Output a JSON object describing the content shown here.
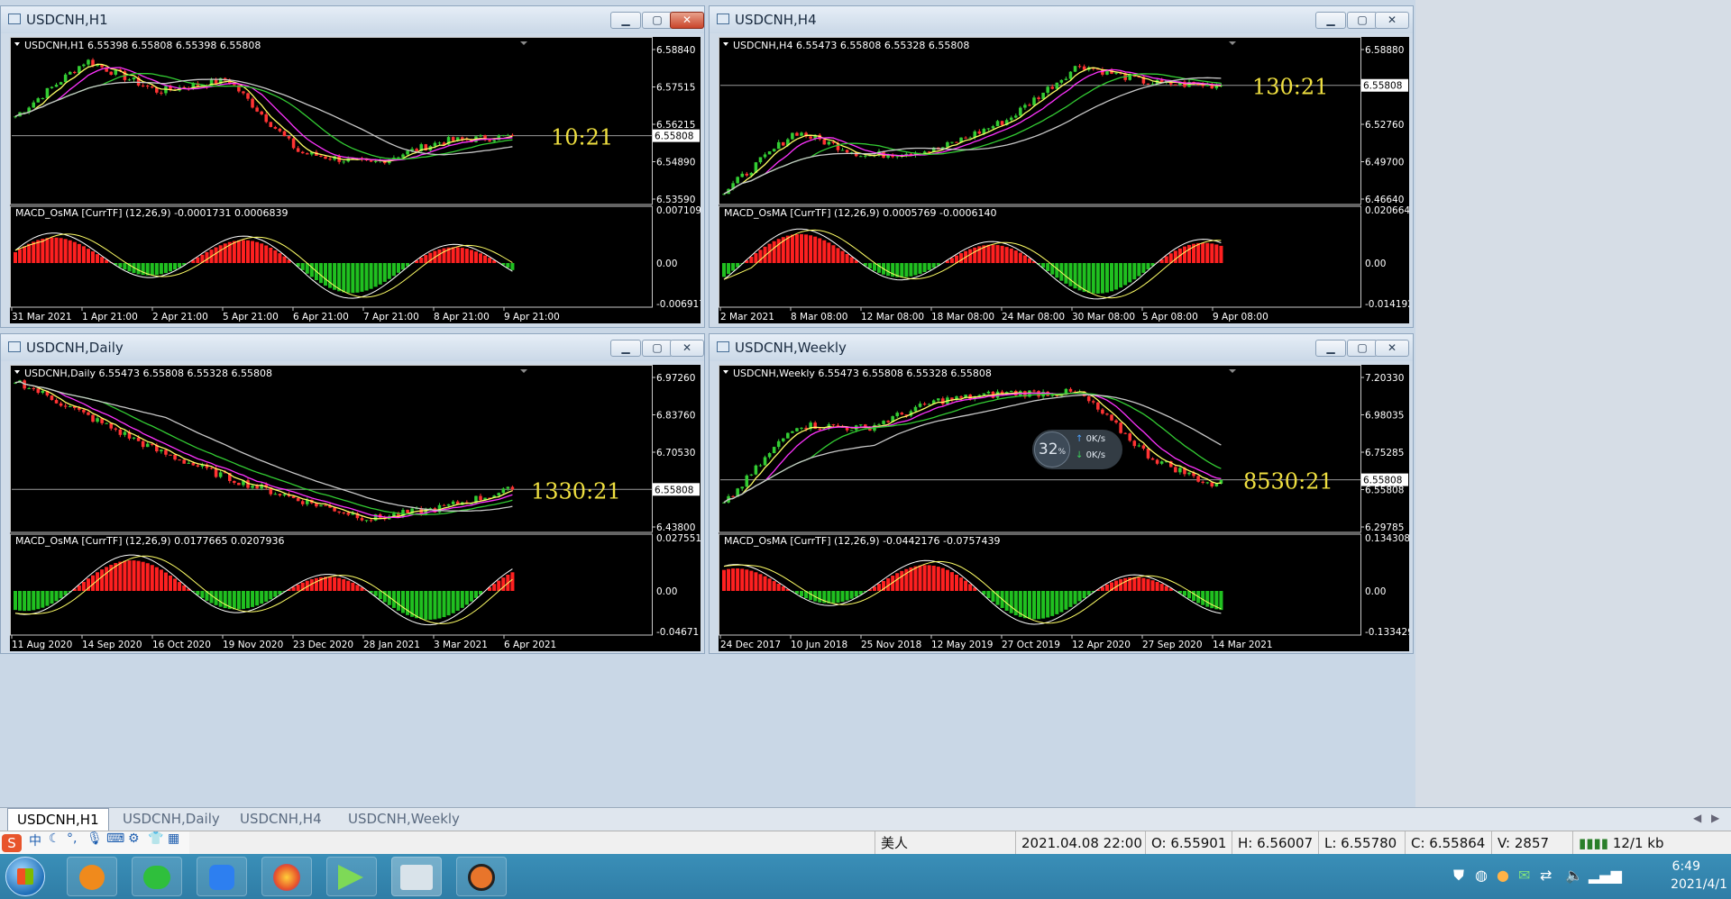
{
  "windows": [
    {
      "id": "h1",
      "title": "USDCNH,H1",
      "header": "USDCNH,H1  6.55398 6.55808 6.55398 6.55808",
      "price_ticks": [
        "6.58840",
        "6.57515",
        "6.56215",
        "6.54890",
        "6.53590"
      ],
      "current_price": "6.55808",
      "macd_label": "MACD_OsMA [CurrTF] (12,26,9) -0.0001731 0.0006839",
      "macd_ticks": [
        "0.007109",
        "0.00",
        "-0.006917"
      ],
      "time_labels": [
        "31 Mar 2021",
        "1 Apr 21:00",
        "2 Apr 21:00",
        "5 Apr 21:00",
        "6 Apr 21:00",
        "7 Apr 21:00",
        "8 Apr 21:00",
        "9 Apr 21:00"
      ],
      "countdown": "10:21",
      "chart_data": {
        "type": "line",
        "ylim": [
          6.5335,
          6.5908
        ],
        "current": 6.55808,
        "x": [
          "31 Mar 2021",
          "1 Apr 21:00",
          "2 Apr 21:00",
          "5 Apr 21:00",
          "6 Apr 21:00",
          "7 Apr 21:00",
          "8 Apr 21:00",
          "9 Apr 21:00"
        ],
        "series": [
          {
            "values": [
              6.565,
              6.585,
              6.574,
              6.578,
              6.552,
              6.548,
              6.556,
              6.558
            ]
          }
        ]
      }
    },
    {
      "id": "h4",
      "title": "USDCNH,H4",
      "header": "USDCNH,H4  6.55473 6.55808 6.55328 6.55808",
      "price_ticks": [
        "6.58880",
        "6.55808",
        "6.52760",
        "6.49700",
        "6.46640"
      ],
      "current_price": "6.55808",
      "macd_label": "MACD_OsMA [CurrTF] (12,26,9) 0.0005769 -0.0006140",
      "macd_ticks": [
        "0.0206644",
        "0.00",
        "-0.0141923"
      ],
      "time_labels": [
        "2 Mar 2021",
        "8 Mar 08:00",
        "12 Mar 08:00",
        "18 Mar 08:00",
        "24 Mar 08:00",
        "30 Mar 08:00",
        "5 Apr 08:00",
        "9 Apr 08:00"
      ],
      "countdown": "130:21",
      "chart_data": {
        "type": "line",
        "ylim": [
          6.46,
          6.592
        ],
        "current": 6.55808,
        "x": [
          "2 Mar 2021",
          "8 Mar 08:00",
          "12 Mar 08:00",
          "18 Mar 08:00",
          "24 Mar 08:00",
          "30 Mar 08:00",
          "5 Apr 08:00",
          "9 Apr 08:00"
        ],
        "series": [
          {
            "values": [
              6.47,
              6.52,
              6.5,
              6.505,
              6.53,
              6.575,
              6.56,
              6.558
            ]
          }
        ]
      }
    },
    {
      "id": "d1",
      "title": "USDCNH,Daily",
      "header": "USDCNH,Daily  6.55473 6.55808 6.55328 6.55808",
      "price_ticks": [
        "6.97260",
        "6.83760",
        "6.70530",
        "6.57060",
        "6.43800"
      ],
      "current_price": "6.55808",
      "macd_label": "MACD_OsMA [CurrTF] (12,26,9) 0.0177665 0.0207936",
      "macd_ticks": [
        "0.0275515",
        "0.00",
        "-0.04671"
      ],
      "time_labels": [
        "11 Aug 2020",
        "14 Sep 2020",
        "16 Oct 2020",
        "19 Nov 2020",
        "23 Dec 2020",
        "28 Jan 2021",
        "3 Mar 2021",
        "6 Apr 2021"
      ],
      "countdown": "1330:21",
      "chart_data": {
        "type": "line",
        "ylim": [
          6.4,
          6.99
        ],
        "current": 6.55808,
        "x": [
          "11 Aug 2020",
          "14 Sep 2020",
          "16 Oct 2020",
          "19 Nov 2020",
          "23 Dec 2020",
          "28 Jan 2021",
          "3 Mar 2021",
          "6 Apr 2021"
        ],
        "series": [
          {
            "values": [
              6.96,
              6.83,
              6.7,
              6.6,
              6.52,
              6.45,
              6.49,
              6.558
            ]
          }
        ]
      }
    },
    {
      "id": "w1",
      "title": "USDCNH,Weekly",
      "header": "USDCNH,Weekly  6.55473 6.55808 6.55328 6.55808",
      "price_ticks": [
        "7.20330",
        "6.98035",
        "6.75285",
        "6.55808",
        "6.29785"
      ],
      "current_price": "6.55808",
      "macd_label": "MACD_OsMA [CurrTF] (12,26,9) -0.0442176 -0.0757439",
      "macd_ticks": [
        "0.1343086",
        "0.00",
        "-0.1334299"
      ],
      "time_labels": [
        "24 Dec 2017",
        "10 Jun 2018",
        "25 Nov 2018",
        "12 May 2019",
        "27 Oct 2019",
        "12 Apr 2020",
        "27 Sep 2020",
        "14 Mar 2021"
      ],
      "countdown": "8530:21",
      "chart_data": {
        "type": "line",
        "ylim": [
          6.23,
          7.23
        ],
        "current": 6.55808,
        "x": [
          "24 Dec 2017",
          "10 Jun 2018",
          "25 Nov 2018",
          "12 May 2019",
          "27 Oct 2019",
          "12 Apr 2020",
          "27 Sep 2020",
          "14 Mar 2021"
        ],
        "series": [
          {
            "values": [
              6.4,
              6.9,
              6.88,
              7.05,
              7.1,
              7.1,
              6.7,
              6.5
            ]
          }
        ]
      }
    }
  ],
  "tabs": [
    "USDCNH,H1",
    "USDCNH,Daily",
    "USDCNH,H4",
    "USDCNH,Weekly"
  ],
  "status": {
    "profile": "美人",
    "datetime": "2021.04.08 22:00",
    "open": "O: 6.55901",
    "high": "H: 6.56007",
    "low": "L: 6.55780",
    "close": "C: 6.55864",
    "volume": "V: 2857",
    "traffic": "12/1 kb"
  },
  "overlay": {
    "percent": "32",
    "percent_sign": "%",
    "up": "0K/s",
    "down": "0K/s"
  },
  "ime": {
    "chinese": "中"
  },
  "tray": {
    "time": "6:49",
    "date": "2021/4/1"
  },
  "colors": {
    "bull_candle": "#33cc33",
    "bear_candle": "#ff3333",
    "ma_yellow": "#ffff66",
    "ma_magenta": "#ff33ff",
    "ma_green": "#33cc33",
    "ma_gray": "#c8c8c8",
    "hist_red": "#ff2020",
    "hist_green": "#20c020",
    "countdown": "#f0e040"
  }
}
